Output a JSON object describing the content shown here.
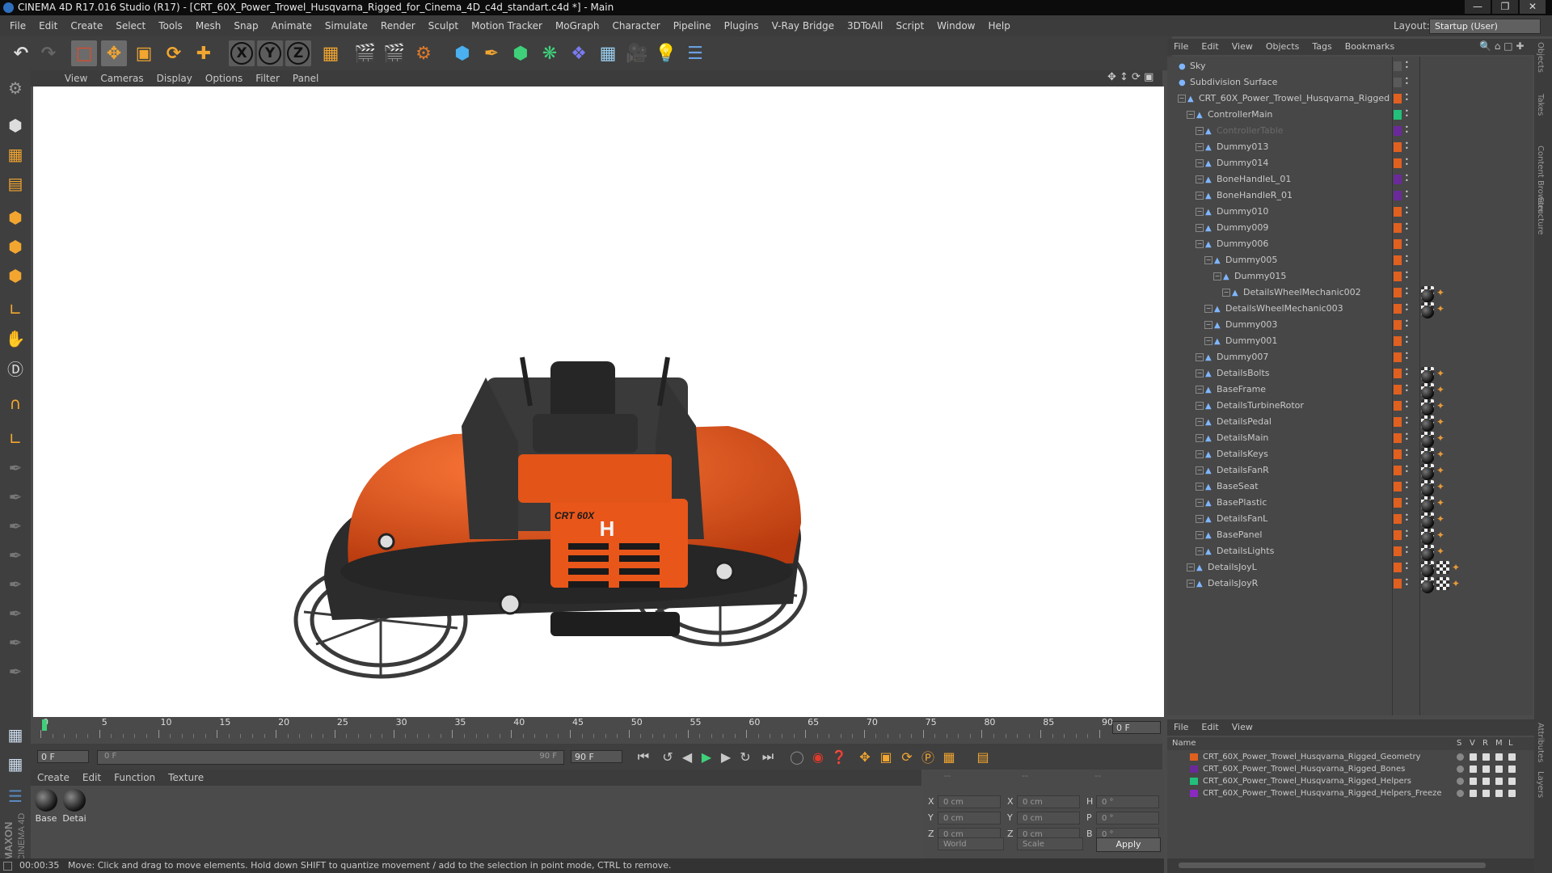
{
  "window": {
    "title": "CINEMA 4D R17.016 Studio (R17) - [CRT_60X_Power_Trowel_Husqvarna_Rigged_for_Cinema_4D_c4d_standart.c4d *] - Main",
    "layout_label": "Layout:",
    "layout_value": "Startup (User)"
  },
  "menubar": [
    "File",
    "Edit",
    "Create",
    "Select",
    "Tools",
    "Mesh",
    "Snap",
    "Animate",
    "Simulate",
    "Render",
    "Sculpt",
    "Motion Tracker",
    "MoGraph",
    "Character",
    "Pipeline",
    "Plugins",
    "V-Ray Bridge",
    "3DToAll",
    "Script",
    "Window",
    "Help"
  ],
  "viewport_menu": [
    "View",
    "Cameras",
    "Display",
    "Options",
    "Filter",
    "Panel"
  ],
  "timeline": {
    "ticks": [
      "0",
      "5",
      "10",
      "15",
      "20",
      "25",
      "30",
      "35",
      "40",
      "45",
      "50",
      "55",
      "60",
      "65",
      "70",
      "75",
      "80",
      "85",
      "90"
    ],
    "current_frame": "0 F",
    "start_field": "0 F",
    "range_start": "0 F",
    "range_end": "90 F",
    "end_field": "90 F"
  },
  "material_menu": [
    "Create",
    "Edit",
    "Function",
    "Texture"
  ],
  "materials": [
    {
      "label": "Base"
    },
    {
      "label": "Detai"
    }
  ],
  "coords": {
    "rows": [
      {
        "a": "X",
        "av": "0 cm",
        "b": "X",
        "bv": "0 cm",
        "c": "H",
        "cv": "0 °"
      },
      {
        "a": "Y",
        "av": "0 cm",
        "b": "Y",
        "bv": "0 cm",
        "c": "P",
        "cv": "0 °"
      },
      {
        "a": "Z",
        "av": "0 cm",
        "b": "Z",
        "bv": "0 cm",
        "c": "B",
        "cv": "0 °"
      }
    ],
    "mode": "World",
    "scale": "Scale",
    "apply": "Apply",
    "header_left": "--",
    "header_mid": "--",
    "header_right": "--"
  },
  "status": {
    "time": "00:00:35",
    "message": "Move: Click and drag to move elements. Hold down SHIFT to quantize movement / add to the selection in point mode, CTRL to remove."
  },
  "object_menu": [
    "File",
    "Edit",
    "View",
    "Objects",
    "Tags",
    "Bookmarks"
  ],
  "objects": [
    {
      "name": "Sky",
      "depth": 0,
      "color": "#5a5a5a",
      "dim": false
    },
    {
      "name": "Subdivision Surface",
      "depth": 0,
      "color": "#5a5a5a",
      "dim": false
    },
    {
      "name": "CRT_60X_Power_Trowel_Husqvarna_Rigged",
      "depth": 1,
      "color": "#e06020",
      "dim": false
    },
    {
      "name": "ControllerMain",
      "depth": 2,
      "color": "#22c07a",
      "dim": false
    },
    {
      "name": "ControllerTable",
      "depth": 3,
      "color": "#6a2a9a",
      "dim": true
    },
    {
      "name": "Dummy013",
      "depth": 3,
      "color": "#e06020",
      "dim": false
    },
    {
      "name": "Dummy014",
      "depth": 3,
      "color": "#e06020",
      "dim": false
    },
    {
      "name": "BoneHandleL_01",
      "depth": 3,
      "color": "#6a2a9a",
      "dim": false
    },
    {
      "name": "BoneHandleR_01",
      "depth": 3,
      "color": "#6a2a9a",
      "dim": false
    },
    {
      "name": "Dummy010",
      "depth": 3,
      "color": "#e06020",
      "dim": false
    },
    {
      "name": "Dummy009",
      "depth": 3,
      "color": "#e06020",
      "dim": false
    },
    {
      "name": "Dummy006",
      "depth": 3,
      "color": "#e06020",
      "dim": false
    },
    {
      "name": "Dummy005",
      "depth": 4,
      "color": "#e06020",
      "dim": false
    },
    {
      "name": "Dummy015",
      "depth": 5,
      "color": "#e06020",
      "dim": false
    },
    {
      "name": "DetailsWheelMechanic002",
      "depth": 6,
      "color": "#e06020",
      "dim": false
    },
    {
      "name": "DetailsWheelMechanic003",
      "depth": 4,
      "color": "#e06020",
      "dim": false
    },
    {
      "name": "Dummy003",
      "depth": 4,
      "color": "#e06020",
      "dim": false
    },
    {
      "name": "Dummy001",
      "depth": 4,
      "color": "#e06020",
      "dim": false
    },
    {
      "name": "Dummy007",
      "depth": 3,
      "color": "#e06020",
      "dim": false
    },
    {
      "name": "DetailsBolts",
      "depth": 3,
      "color": "#e06020",
      "dim": false
    },
    {
      "name": "BaseFrame",
      "depth": 3,
      "color": "#e06020",
      "dim": false
    },
    {
      "name": "DetailsTurbineRotor",
      "depth": 3,
      "color": "#e06020",
      "dim": false
    },
    {
      "name": "DetailsPedal",
      "depth": 3,
      "color": "#e06020",
      "dim": false
    },
    {
      "name": "DetailsMain",
      "depth": 3,
      "color": "#e06020",
      "dim": false
    },
    {
      "name": "DetailsKeys",
      "depth": 3,
      "color": "#e06020",
      "dim": false
    },
    {
      "name": "DetailsFanR",
      "depth": 3,
      "color": "#e06020",
      "dim": false
    },
    {
      "name": "BaseSeat",
      "depth": 3,
      "color": "#e06020",
      "dim": false
    },
    {
      "name": "BasePlastic",
      "depth": 3,
      "color": "#e06020",
      "dim": false
    },
    {
      "name": "DetailsFanL",
      "depth": 3,
      "color": "#e06020",
      "dim": false
    },
    {
      "name": "BasePanel",
      "depth": 3,
      "color": "#e06020",
      "dim": false
    },
    {
      "name": "DetailsLights",
      "depth": 3,
      "color": "#e06020",
      "dim": false
    },
    {
      "name": "DetailsJoyL",
      "depth": 2,
      "color": "#e06020",
      "dim": false
    },
    {
      "name": "DetailsJoyR",
      "depth": 2,
      "color": "#e06020",
      "dim": false
    }
  ],
  "layer_menu": [
    "File",
    "Edit",
    "View"
  ],
  "layer_columns": {
    "name": "Name",
    "s": "S",
    "v": "V",
    "r": "R",
    "m": "M",
    "l": "L"
  },
  "layers": [
    {
      "name": "CRT_60X_Power_Trowel_Husqvarna_Rigged_Geometry",
      "color": "#e06020"
    },
    {
      "name": "CRT_60X_Power_Trowel_Husqvarna_Rigged_Bones",
      "color": "#6a2a9a"
    },
    {
      "name": "CRT_60X_Power_Trowel_Husqvarna_Rigged_Helpers",
      "color": "#22c07a"
    },
    {
      "name": "CRT_60X_Power_Trowel_Husqvarna_Rigged_Helpers_Freeze",
      "color": "#8a2ac0"
    }
  ],
  "side_tabs": [
    "Objects",
    "Takes",
    "Content Browser",
    "Structure"
  ],
  "side_tabs_lower": [
    "Attributes",
    "Layers"
  ],
  "machine": {
    "model_label": "CRT 60X"
  }
}
